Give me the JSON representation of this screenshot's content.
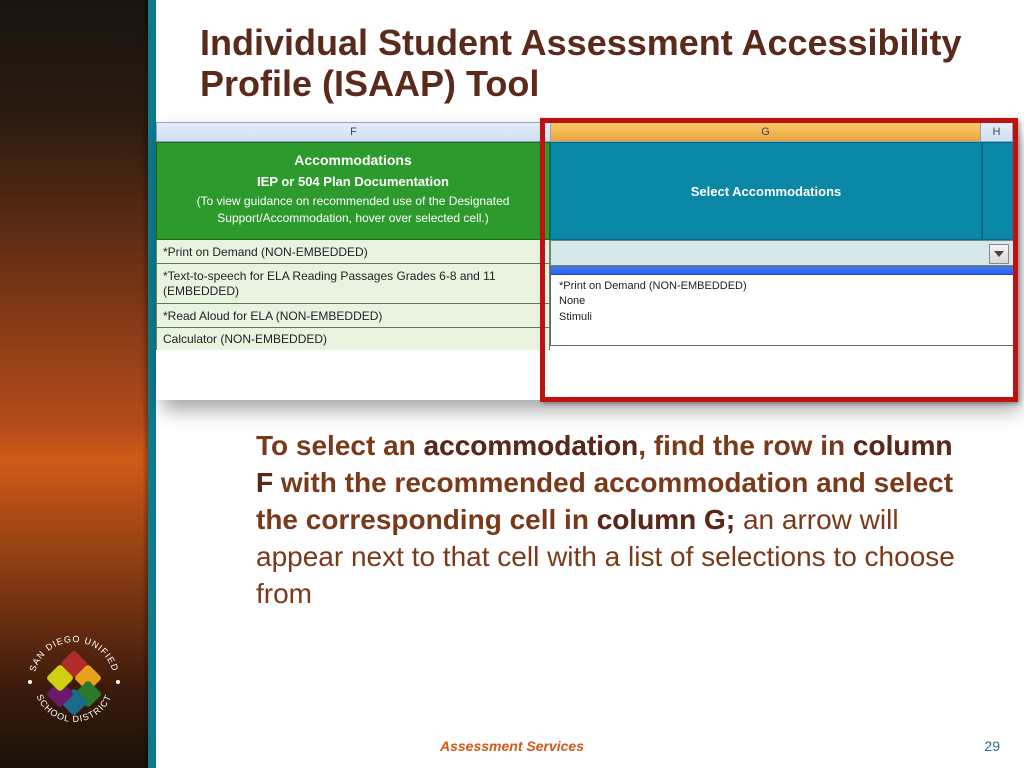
{
  "title": "Individual Student Assessment Accessibility Profile (ISAAP) Tool",
  "columns": {
    "f": "F",
    "g": "G",
    "h": "H"
  },
  "column_g_highlight": {
    "label": "G",
    "selected": true
  },
  "headers": {
    "f": {
      "line1": "Accommodations",
      "line2": "IEP or 504 Plan Documentation",
      "line3": "(To view guidance on recommended use of the Designated Support/Accommodation, hover over selected cell.)"
    },
    "g": "Select Accommodations"
  },
  "rows": [
    "*Print on Demand (NON-EMBEDDED)",
    "*Text-to-speech for ELA Reading Passages Grades 6-8 and 11 (EMBEDDED)",
    "*Read Aloud for ELA (NON-EMBEDDED)",
    "Calculator (NON-EMBEDDED)"
  ],
  "dropdown": {
    "options": [
      "*Print on Demand (NON-EMBEDDED)",
      "None",
      "Stimuli"
    ]
  },
  "instruction": {
    "t1": "To select an ",
    "k1": "accommodation",
    "t2": ", find the row in ",
    "k2": "column F",
    "t3": " with the recommended accommodation  and select the corresponding cell in ",
    "k3": "column G;",
    "t4": " an arrow will appear next to that cell with a list of selections to choose from"
  },
  "footer": "Assessment Services",
  "page": "29",
  "logo": {
    "top": "SAN DIEGO UNIFIED",
    "bottom": "SCHOOL DISTRICT"
  }
}
